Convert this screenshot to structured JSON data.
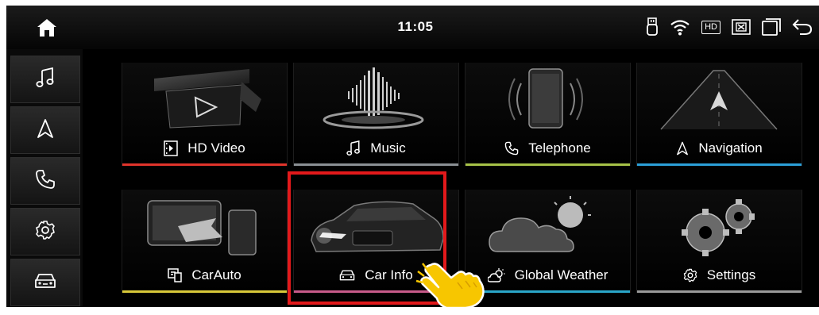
{
  "status_bar": {
    "time": "11:05",
    "hd_label": "HD",
    "icons": [
      "home-icon",
      "usb-icon",
      "wifi-icon",
      "hd-icon",
      "close-box-icon",
      "window-icon",
      "back-icon"
    ]
  },
  "sidebar": {
    "items": [
      {
        "icon": "music-note-icon"
      },
      {
        "icon": "navigation-arrow-icon"
      },
      {
        "icon": "phone-icon"
      },
      {
        "icon": "gear-icon"
      },
      {
        "icon": "car-icon"
      }
    ]
  },
  "apps": [
    {
      "label": "HD Video",
      "icon": "video-file-icon",
      "accent": "#e0342b"
    },
    {
      "label": "Music",
      "icon": "music-note-icon",
      "accent": "#8a8f94"
    },
    {
      "label": "Telephone",
      "icon": "phone-icon",
      "accent": "#a7c248"
    },
    {
      "label": "Navigation",
      "icon": "navigation-arrow-icon",
      "accent": "#2b9fd8"
    },
    {
      "label": "CarAuto",
      "icon": "carauto-icon",
      "accent": "#d9c93a"
    },
    {
      "label": "Car Info",
      "icon": "car-icon",
      "accent": "#c85a8a"
    },
    {
      "label": "Global Weather",
      "icon": "weather-icon",
      "accent": "#2aa6c9"
    },
    {
      "label": "Settings",
      "icon": "gear-icon",
      "accent": "#9a9a9a"
    }
  ],
  "colors": {
    "background": "#000000",
    "highlight_box": "#e3191b",
    "pointer_hand": "#f7c600"
  }
}
